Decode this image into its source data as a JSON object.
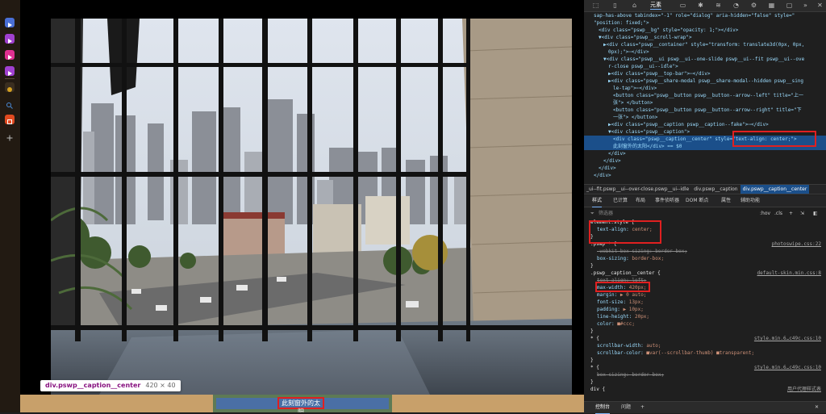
{
  "rail": {
    "items": [
      {
        "name": "play-icon",
        "color": "#4a6fd6"
      },
      {
        "name": "play-icon",
        "color": "#a040d0"
      },
      {
        "name": "play-icon",
        "color": "#e03090"
      },
      {
        "name": "play-icon",
        "color": "#a040d0"
      },
      {
        "name": "sun-icon",
        "color": "#d4a020"
      },
      {
        "name": "search-icon",
        "color": "#4a8ad6"
      },
      {
        "name": "app-icon",
        "color": "#e04a20"
      },
      {
        "name": "plus-icon",
        "color": "#bbbbbb"
      }
    ]
  },
  "viewer": {
    "caption_text": "此刻窗外的太阳",
    "tooltip": {
      "tag": "div.pswp__caption__center",
      "dims": "420 × 40"
    }
  },
  "devtools": {
    "toolbar_tab": "元素",
    "elements": [
      {
        "text": "sap-has-above tabindex=\"-1\" role=\"dialog\" aria-hidden=\"false\" style=\"",
        "indent": 4
      },
      {
        "text": "\"position: fixed;\">",
        "indent": 4
      },
      {
        "text": "<div class=\"pswp__bg\" style=\"opacity: 1;\"></div>",
        "indent": 6
      },
      {
        "text": "▼<div class=\"pswp__scroll-wrap\">",
        "indent": 6
      },
      {
        "text": "▶<div class=\"pswp__container\" style=\"transform: translate3d(0px, 0px,",
        "indent": 8
      },
      {
        "text": "0px);\">⋯</div>",
        "indent": 10
      },
      {
        "text": "▼<div class=\"pswp__ui pswp__ui--one-slide pswp__ui--fit pswp__ui--ove",
        "indent": 8
      },
      {
        "text": "r-close pswp__ui--idle\">",
        "indent": 10
      },
      {
        "text": "▶<div class=\"pswp__top-bar\">⋯</div>",
        "indent": 10
      },
      {
        "text": "▶<div class=\"pswp__share-modal pswp__share-modal--hidden pswp__sing",
        "indent": 10
      },
      {
        "text": "le-tap\">⋯</div>",
        "indent": 12
      },
      {
        "text": "<button class=\"pswp__button pswp__button--arrow--left\" title=\"上一",
        "indent": 12
      },
      {
        "text": "张\"> </button>",
        "indent": 12
      },
      {
        "text": "<button class=\"pswp__button pswp__button--arrow--right\" title=\"下",
        "indent": 12
      },
      {
        "text": "一张\"> </button>",
        "indent": 12
      },
      {
        "text": "▶<div class=\"pswp__caption pswp__caption--fake\">⋯</div>",
        "indent": 10
      },
      {
        "text": "▼<div class=\"pswp__caption\">",
        "indent": 10
      },
      {
        "text": "<div class=\"pswp__caption__center\" style=\"text-align: center;\">",
        "indent": 12,
        "selected": true
      },
      {
        "text": "此刻窗外的太阳</div> == $0",
        "indent": 12,
        "selected": true
      },
      {
        "text": "</div>",
        "indent": 10
      },
      {
        "text": "</div>",
        "indent": 8
      },
      {
        "text": "</div>",
        "indent": 6
      },
      {
        "text": "</div>",
        "indent": 4
      }
    ],
    "breadcrumbs": [
      "_ui--fit.pswp__ui--over-close.pswp__ui--idle",
      "div.pswp__caption",
      "div.pswp__caption__center"
    ],
    "subtabs": [
      "样式",
      "已计算",
      "布局",
      "事件侦听器",
      "DOM 断点",
      "属性",
      "辅助功能"
    ],
    "filter": {
      "placeholder": "筛选器",
      "hov": ":hov",
      "cls": ".cls"
    },
    "styles": [
      {
        "sel": "element.style {",
        "src": ""
      },
      {
        "prop": "text-align",
        "val": "center;"
      },
      {
        "close": "}"
      },
      {
        "sel": ".pswp * {",
        "src": "photoswipe.css:22"
      },
      {
        "prop": "-webkit-box-sizing",
        "val": "border-box;",
        "strike": true
      },
      {
        "prop": "box-sizing",
        "val": "border-box;"
      },
      {
        "close": "}"
      },
      {
        "sel": ".pswp__caption__center {",
        "src": "default-skin.min.css:8"
      },
      {
        "prop": "text-align",
        "val": "left;",
        "strike": true
      },
      {
        "prop": "max-width",
        "val": "420px;"
      },
      {
        "prop": "margin",
        "val": "▶ 0 auto;"
      },
      {
        "prop": "font-size",
        "val": "13px;"
      },
      {
        "prop": "padding",
        "val": "▶ 10px;"
      },
      {
        "prop": "line-height",
        "val": "20px;"
      },
      {
        "prop": "color",
        "val": "■#ccc;"
      },
      {
        "close": "}"
      },
      {
        "sel": "* {",
        "src": "style.min.6…c49c.css:10"
      },
      {
        "prop": "scrollbar-width",
        "val": "auto;"
      },
      {
        "prop": "scrollbar-color",
        "val": "■var(--scrollbar-thumb) ■transparent;"
      },
      {
        "close": "}"
      },
      {
        "sel": "* {",
        "src": "style.min.6…c49c.css:10"
      },
      {
        "prop": "box-sizing",
        "val": "border-box;",
        "strike": true
      },
      {
        "close": "}"
      },
      {
        "sel": "div {",
        "src": "用户代理样式表"
      }
    ],
    "drawer_tabs": [
      "控制台",
      "问题",
      "+"
    ]
  }
}
